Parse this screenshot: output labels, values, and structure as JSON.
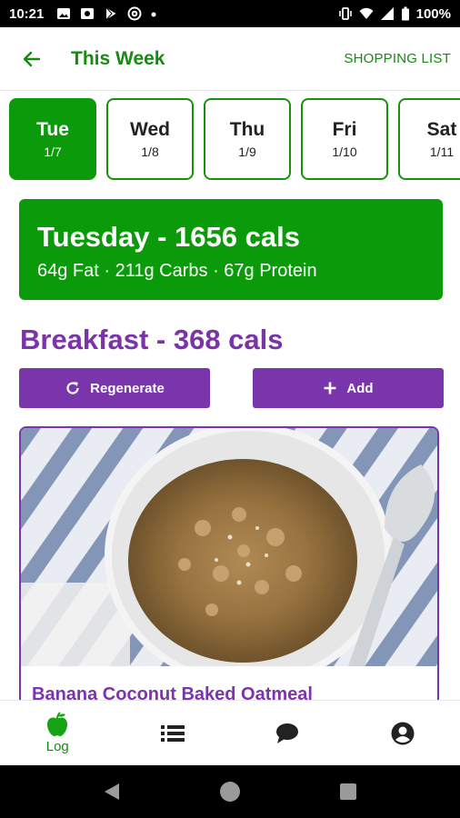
{
  "status_bar": {
    "time": "10:21",
    "battery": "100%"
  },
  "app_bar": {
    "title": "This Week",
    "shopping_list": "SHOPPING LIST"
  },
  "days": [
    {
      "name": "Tue",
      "date": "1/7",
      "selected": true
    },
    {
      "name": "Wed",
      "date": "1/8",
      "selected": false
    },
    {
      "name": "Thu",
      "date": "1/9",
      "selected": false
    },
    {
      "name": "Fri",
      "date": "1/10",
      "selected": false
    },
    {
      "name": "Sat",
      "date": "1/11",
      "selected": false
    }
  ],
  "summary": {
    "title": "Tuesday - 1656 cals",
    "macros": "64g Fat · 211g Carbs · 67g Protein"
  },
  "meal": {
    "title": "Breakfast - 368 cals",
    "regenerate_label": "Regenerate",
    "add_label": "Add",
    "recipe_name": "Banana Coconut Baked Oatmeal"
  },
  "bottom_nav": {
    "log_label": "Log"
  },
  "colors": {
    "green": "#0b9a0a",
    "green_text": "#178a11",
    "purple": "#7b35ac"
  }
}
